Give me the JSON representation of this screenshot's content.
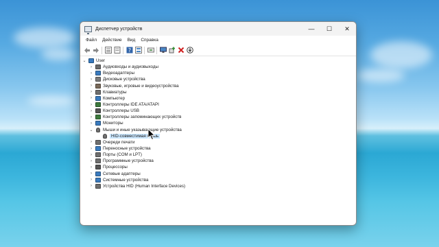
{
  "window": {
    "title": "Диспетчер устройств",
    "controls": {
      "minimize": "—",
      "maximize": "☐",
      "close": "✕"
    }
  },
  "menu": [
    "Файл",
    "Действие",
    "Вид",
    "Справка"
  ],
  "toolbar": {
    "icons": [
      "back-arrow-icon",
      "forward-arrow-icon",
      "properties-list-icon",
      "properties-icon",
      "help-icon",
      "device-list-icon",
      "refresh-scan-icon",
      "monitor-icon",
      "add-driver-icon",
      "uninstall-x-icon",
      "download-driver-icon"
    ]
  },
  "tree": {
    "root": "User",
    "nodes": [
      {
        "label": "Аудиовходы и аудиовыходы",
        "icon": "speaker-icon",
        "color": "#6b6b6b",
        "expanded": false
      },
      {
        "label": "Видеоадаптеры",
        "icon": "display-adapter-icon",
        "color": "#3a7bbf",
        "expanded": false
      },
      {
        "label": "Дисковые устройства",
        "icon": "disk-icon",
        "color": "#7b7b7b",
        "expanded": false
      },
      {
        "label": "Звуковые, игровые и видеоустройства",
        "icon": "sound-icon",
        "color": "#7a6a5a",
        "expanded": false
      },
      {
        "label": "Клавиатуры",
        "icon": "keyboard-icon",
        "color": "#6f6f6f",
        "expanded": false
      },
      {
        "label": "Компьютер",
        "icon": "computer-icon",
        "color": "#3a7bbf",
        "expanded": false
      },
      {
        "label": "Контроллеры IDE ATA/ATAPI",
        "icon": "ide-controller-icon",
        "color": "#3d7a3d",
        "expanded": false
      },
      {
        "label": "Контроллеры USB",
        "icon": "usb-icon",
        "color": "#555555",
        "expanded": false
      },
      {
        "label": "Контроллеры запоминающих устройств",
        "icon": "storage-controller-icon",
        "color": "#3d7a3d",
        "expanded": false
      },
      {
        "label": "Мониторы",
        "icon": "monitor-icon",
        "color": "#3a7bbf",
        "expanded": false
      },
      {
        "label": "Мыши и иные указывающие устройства",
        "icon": "mouse-icon",
        "color": "#6f6f6f",
        "expanded": true
      },
      {
        "label": "HID-совместимая мышь",
        "icon": "mouse-icon",
        "color": "#6f6f6f",
        "child": true,
        "selected": true
      },
      {
        "label": "Очереди печати",
        "icon": "printer-icon",
        "color": "#6f6f6f",
        "expanded": false
      },
      {
        "label": "Переносные устройства",
        "icon": "portable-device-icon",
        "color": "#3a7bbf",
        "expanded": false
      },
      {
        "label": "Порты (COM и LPT)",
        "icon": "port-icon",
        "color": "#6f6f6f",
        "expanded": false
      },
      {
        "label": "Программные устройства",
        "icon": "software-device-icon",
        "color": "#6f6f6f",
        "expanded": false
      },
      {
        "label": "Процессоры",
        "icon": "processor-icon",
        "color": "#555555",
        "expanded": false
      },
      {
        "label": "Сетевые адаптеры",
        "icon": "network-adapter-icon",
        "color": "#3a7bbf",
        "expanded": false
      },
      {
        "label": "Системные устройства",
        "icon": "system-device-icon",
        "color": "#3a7bbf",
        "expanded": false
      },
      {
        "label": "Устройства HID (Human Interface Devices)",
        "icon": "hid-icon",
        "color": "#6f6f6f",
        "expanded": false
      }
    ]
  }
}
